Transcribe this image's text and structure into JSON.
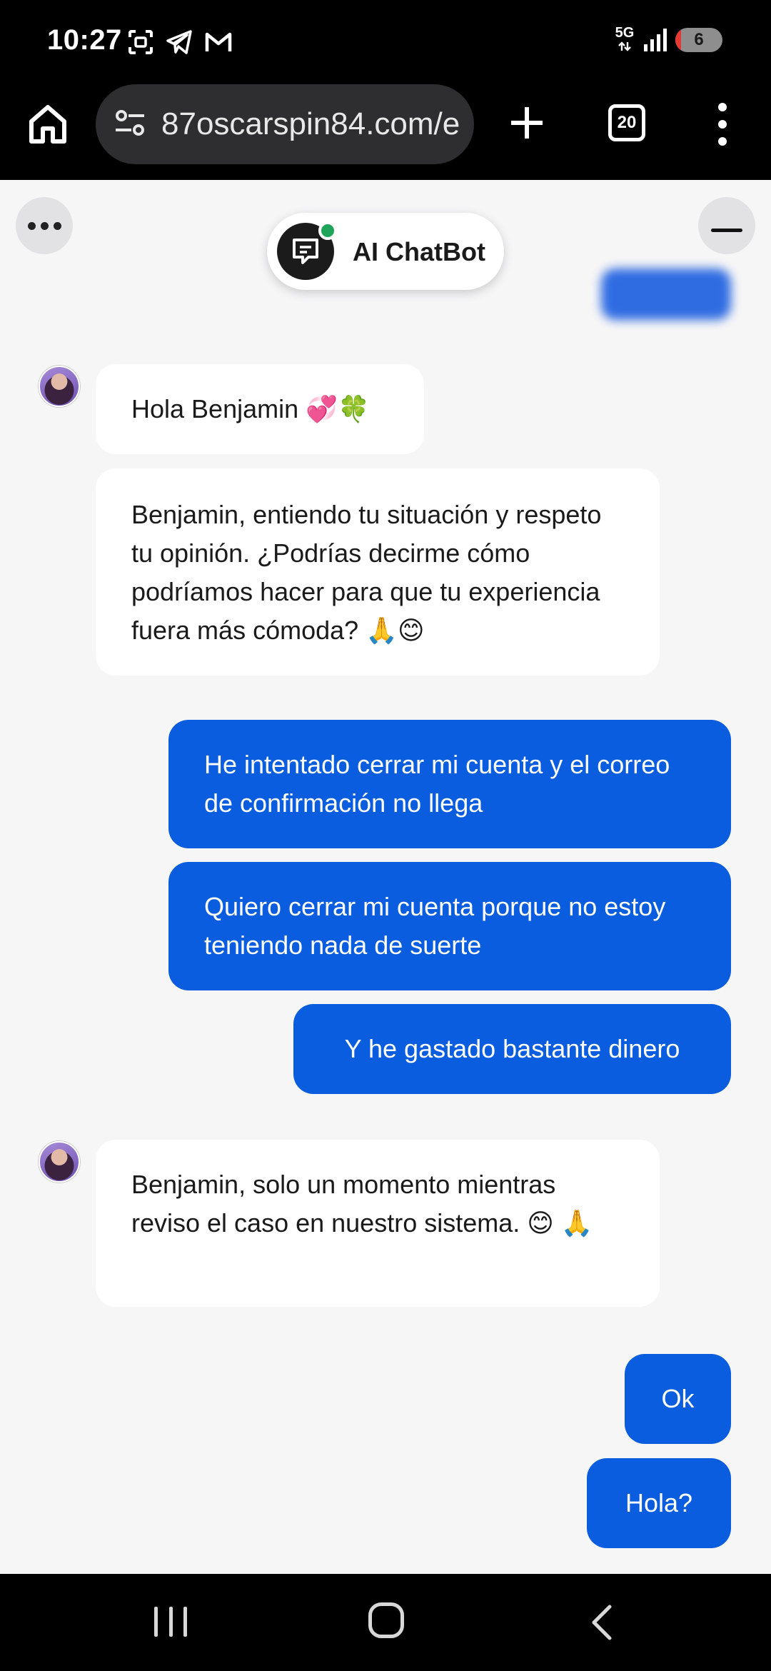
{
  "status_bar": {
    "time": "10:27",
    "network": "5G",
    "battery": "6",
    "left_icons": [
      "screenshot-icon",
      "telegram-icon",
      "gmail-icon"
    ]
  },
  "browser": {
    "url": "87oscarspin84.com/e",
    "tab_count": "20"
  },
  "chat": {
    "bot_name": "AI ChatBot",
    "messages": [
      {
        "from": "agent",
        "text": "Hola Benjamin 💞🍀"
      },
      {
        "from": "agent",
        "text": "Benjamin, entiendo tu situación y respeto tu opinión. ¿Podrías decirme cómo podríamos hacer para que tu experiencia fuera más cómoda? 🙏😊"
      },
      {
        "from": "user",
        "text": "He intentado cerrar mi cuenta y el correo de confirmación no llega"
      },
      {
        "from": "user",
        "text": "Quiero cerrar mi cuenta porque no estoy teniendo nada de suerte"
      },
      {
        "from": "user",
        "text": "Y he gastado bastante dinero"
      },
      {
        "from": "agent",
        "text": "Benjamin, solo un momento mientras reviso el caso en nuestro sistema. 😊 🙏"
      },
      {
        "from": "user",
        "text": "Ok"
      },
      {
        "from": "user",
        "text": "Hola?"
      }
    ]
  },
  "colors": {
    "user_bubble": "#0a5ddf",
    "agent_bubble": "#ffffff",
    "chat_background": "#f6f6f7",
    "online_dot": "#1fa559"
  }
}
